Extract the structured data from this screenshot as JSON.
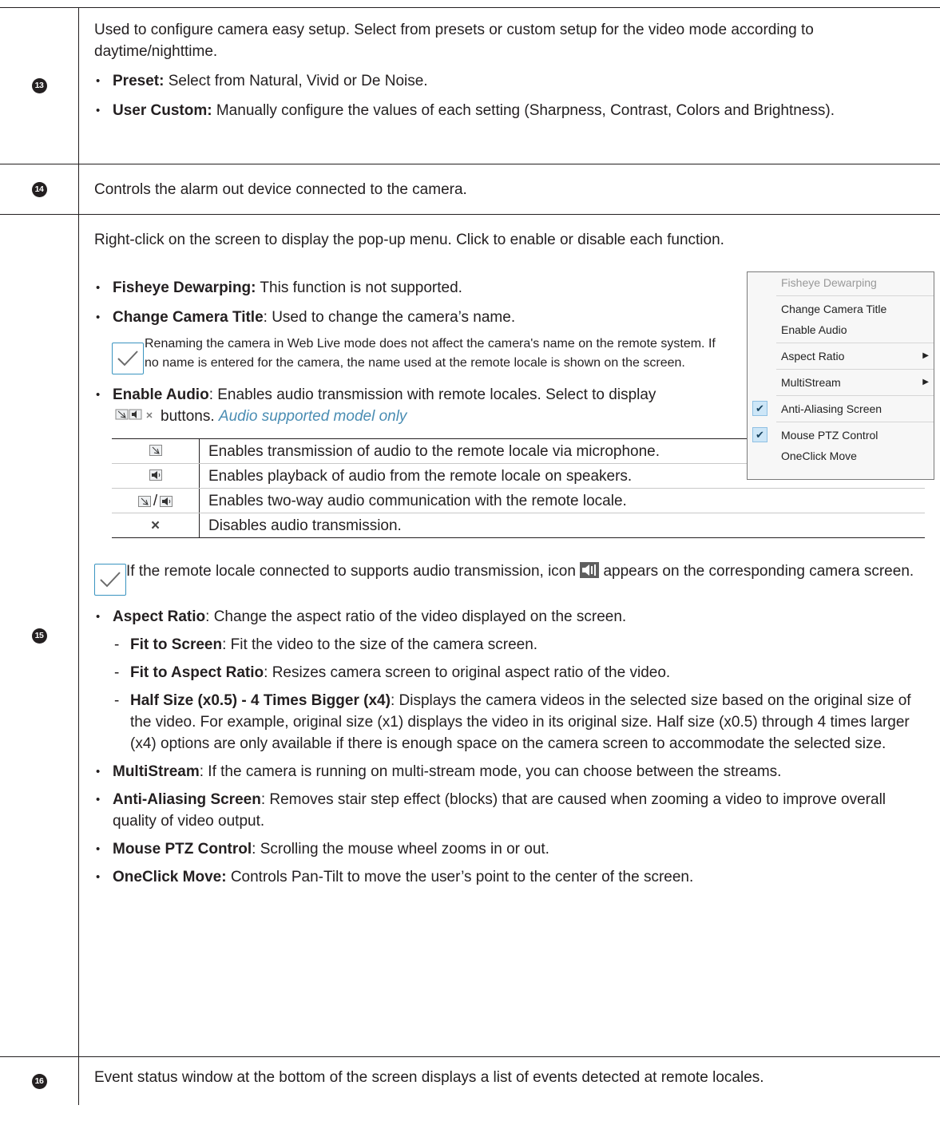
{
  "rows": [
    {
      "number": "13",
      "intro": "Used to configure camera easy setup. Select from presets or custom setup for the video mode according to daytime/nighttime.",
      "bullets": [
        {
          "term": "Preset:",
          "text": " Select from Natural, Vivid or De Noise."
        },
        {
          "term": "User Custom:",
          "text": " Manually configure the values of each setting (Sharpness, Contrast, Colors and Brightness)."
        }
      ]
    },
    {
      "number": "14",
      "text": "Controls the alarm out device connected to the camera."
    },
    {
      "number": "15",
      "intro": "Right-click on the screen to display the pop-up menu. Click to enable or disable each function.",
      "fisheye": {
        "term": "Fisheye Dewarping:",
        "text": " This function is not supported."
      },
      "change_title": {
        "term": "Change Camera Title",
        "text": ": Used to change the camera’s name."
      },
      "note1": "Renaming the camera in Web Live mode does not affect the camera's name on the remote system. If no name is entered for the camera, the name used at the remote locale is shown on the screen.",
      "enable_audio": {
        "term": "Enable Audio",
        "text": ": Enables audio transmission with remote locales. Select to display",
        "text2": "buttons.",
        "note": "Audio supported model only"
      },
      "audio_table": [
        {
          "icon": "microphone-icon",
          "text": "Enables transmission of audio to the remote locale via microphone."
        },
        {
          "icon": "speaker-icon",
          "text": "Enables playback of audio from the remote locale on speakers."
        },
        {
          "icon": "microphone-speaker-icon",
          "slash": "/",
          "text": "Enables two-way audio communication with the remote locale."
        },
        {
          "icon": "close-icon",
          "glyph": "×",
          "text": "Disables audio transmission."
        }
      ],
      "note2_a": "If the remote locale connected to supports audio transmission,  icon",
      "note2_b": "appears on the corresponding camera screen.",
      "aspect": {
        "term": "Aspect Ratio",
        "text": ": Change the aspect ratio of the video displayed on the screen."
      },
      "aspect_items": [
        {
          "term": "Fit to Screen",
          "text": ": Fit the video to the size of the camera screen."
        },
        {
          "term": "Fit to Aspect Ratio",
          "text": ": Resizes camera screen to original aspect ratio of the video."
        },
        {
          "term": "Half Size (x0.5) - 4 Times Bigger (x4)",
          "text": ": Displays the camera videos in the selected size based on the original size of the video. For example, original size (x1) displays the video in its original size. Half size (x0.5) through 4 times larger (x4) options are only available if there is enough space on the camera screen to accommodate the selected size."
        }
      ],
      "multistream": {
        "term": "MultiStream",
        "text": ": If the camera is running on multi-stream mode, you can choose between the streams."
      },
      "antialias": {
        "term": "Anti-Aliasing Screen",
        "text": ": Removes stair step effect (blocks) that are caused when zooming a video to improve overall quality of video output."
      },
      "mouseptz": {
        "term": "Mouse PTZ Control",
        "text": ":  Scrolling the mouse wheel zooms in or out."
      },
      "oneclick": {
        "term": "OneClick Move:",
        "text": " Controls Pan-Tilt to move the user’s point to the center of the screen."
      }
    },
    {
      "number": "16",
      "text": "Event status window at the bottom of the screen displays a list of events detected at remote locales."
    }
  ],
  "popup_menu": {
    "items": [
      {
        "label": "Fisheye Dewarping",
        "disabled": true
      },
      {
        "label": "Change Camera Title"
      },
      {
        "label": "Enable Audio"
      },
      {
        "label": "Aspect Ratio",
        "submenu": true
      },
      {
        "label": "MultiStream",
        "submenu": true
      },
      {
        "label": "Anti-Aliasing Screen",
        "checked": true
      },
      {
        "label": "Mouse PTZ Control",
        "checked": true
      },
      {
        "label": "OneClick Move"
      }
    ],
    "check_glyph": "✔",
    "arrow_glyph": "▶"
  },
  "colors": {
    "text": "#231f20",
    "accent": "#3a94c0",
    "note_italic": "#4a8db3"
  }
}
